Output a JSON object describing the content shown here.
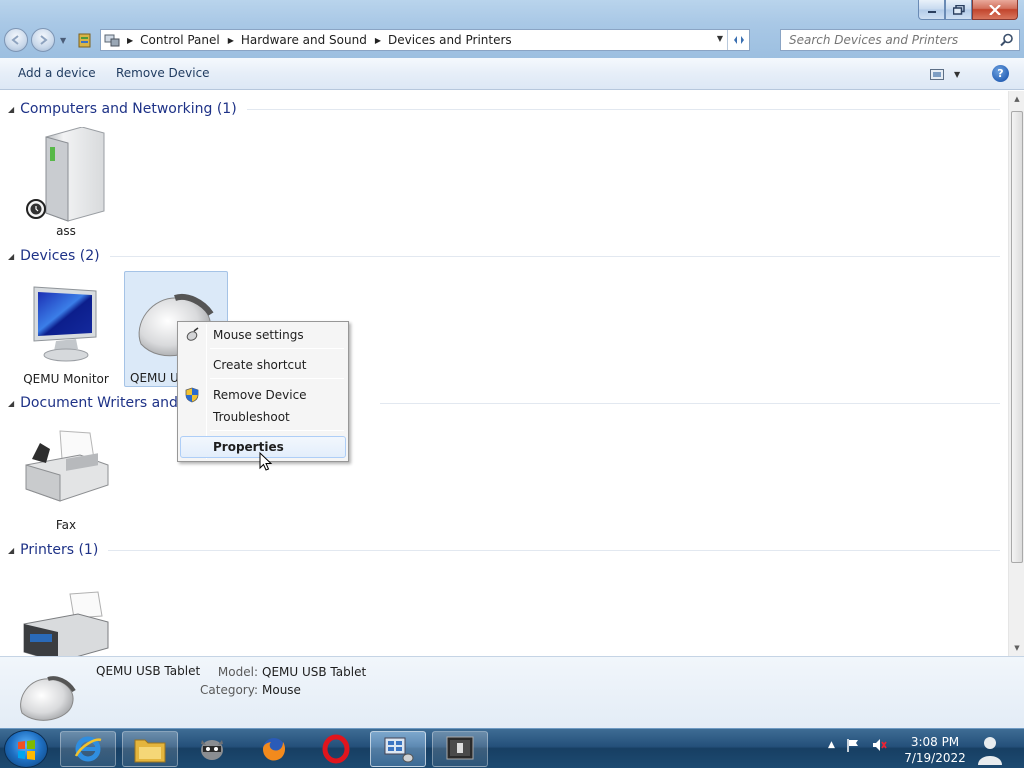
{
  "window": {
    "controls": {
      "minimize": "minimize",
      "maximize": "maximize",
      "close": "close"
    }
  },
  "address_bar": {
    "crumbs": [
      "Control Panel",
      "Hardware and Sound",
      "Devices and Printers"
    ]
  },
  "search": {
    "placeholder": "Search Devices and Printers"
  },
  "command_bar": {
    "add_device": "Add a device",
    "remove_device": "Remove Device",
    "help": "?"
  },
  "groups": [
    {
      "title": "Computers and Networking (1)",
      "devices": [
        {
          "label": "ass",
          "icon": "computer-icon"
        }
      ]
    },
    {
      "title": "Devices (2)",
      "devices": [
        {
          "label": "QEMU Monitor",
          "icon": "monitor-icon"
        },
        {
          "label": "QEMU USB Tablet",
          "icon": "mouse-icon",
          "visible_label": "QEMU US",
          "selected": true
        }
      ]
    },
    {
      "title": "Document Writers and Printers",
      "visible_title": "Document Writers and F",
      "devices": [
        {
          "label": "Fax",
          "icon": "fax-icon"
        }
      ]
    },
    {
      "title": "Printers (1)",
      "devices": [
        {
          "label": "",
          "icon": "printer-icon"
        }
      ]
    }
  ],
  "context_menu": {
    "items": [
      {
        "label": "Mouse settings",
        "icon": "mouse-settings-icon"
      },
      {
        "label": "Create shortcut"
      },
      {
        "label": "Remove Device",
        "icon": "uac-shield-icon"
      },
      {
        "label": "Troubleshoot"
      },
      {
        "label": "Properties",
        "bold": true,
        "hover": true
      }
    ]
  },
  "details_pane": {
    "name": "QEMU USB Tablet",
    "model_label": "Model:",
    "model_value": "QEMU USB Tablet",
    "category_label": "Category:",
    "category_value": "Mouse"
  },
  "taskbar": {
    "apps": [
      "internet-explorer-icon",
      "file-explorer-icon",
      "raccoon-app-icon",
      "firefox-icon",
      "opera-icon",
      "devices-and-printers-icon",
      "task-app-icon"
    ],
    "clock_time": "3:08 PM",
    "clock_date": "7/19/2022"
  },
  "colors": {
    "group_header": "#1e3287",
    "selection": "#dbe9f8",
    "taskbar": "#24507a"
  }
}
